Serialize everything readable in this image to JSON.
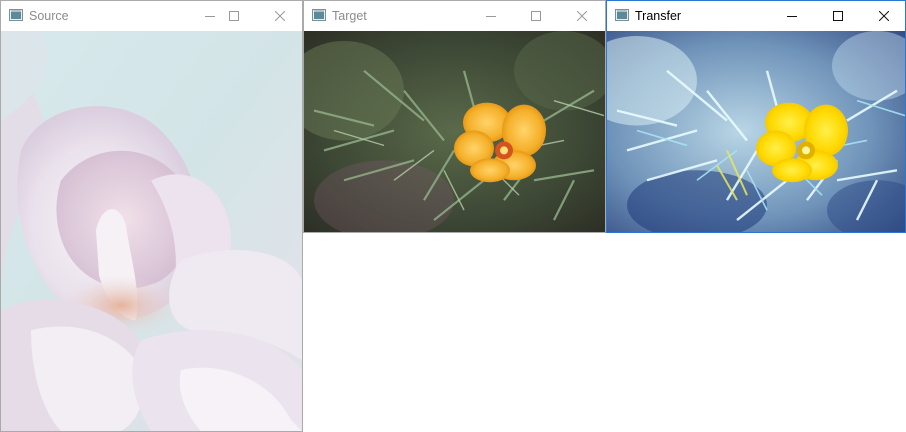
{
  "windows": {
    "source": {
      "title": "Source",
      "icon": "app-window-icon",
      "controls": [
        "minimize-icon",
        "maximize-icon",
        "close-icon"
      ],
      "focused": false
    },
    "target": {
      "title": "Target",
      "icon": "app-window-icon",
      "controls": [
        "minimize-icon",
        "maximize-icon",
        "close-icon"
      ],
      "focused": false
    },
    "transfer": {
      "title": "Transfer",
      "icon": "app-window-icon",
      "controls": [
        "minimize-icon",
        "maximize-icon",
        "close-icon"
      ],
      "focused": true
    }
  },
  "colors": {
    "active_border": "#2b78d4",
    "inactive_title": "#8c8c8c",
    "active_title": "#000000"
  }
}
